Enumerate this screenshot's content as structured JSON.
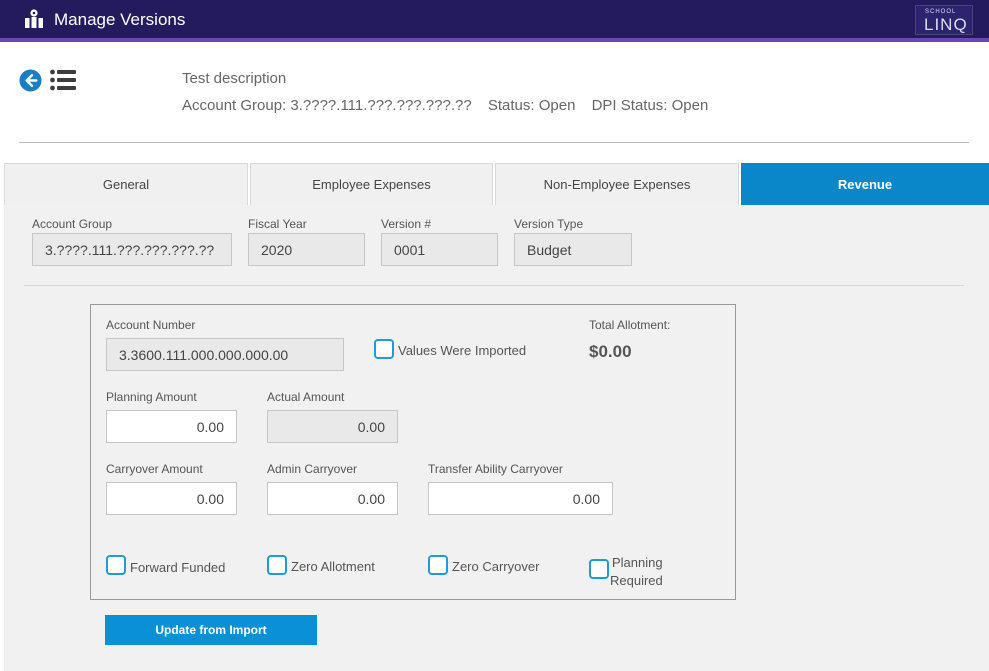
{
  "app": {
    "title": "Manage Versions",
    "logo_top": "SCHOOL",
    "logo_main": "LINQ"
  },
  "header": {
    "description": "Test description",
    "account_group": "Account Group: 3.????.111.???.???.???.??",
    "status": "Status: Open",
    "dpi_status": "DPI Status: Open"
  },
  "tabs": [
    {
      "label": "General",
      "active": false
    },
    {
      "label": "Employee Expenses",
      "active": false
    },
    {
      "label": "Non-Employee Expenses",
      "active": false
    },
    {
      "label": "Revenue",
      "active": true
    }
  ],
  "version_info": {
    "account_group_label": "Account Group",
    "account_group_value": "3.????.111.???.???.???.??",
    "fiscal_year_label": "Fiscal Year",
    "fiscal_year_value": "2020",
    "version_label": "Version #",
    "version_value": "0001",
    "version_type_label": "Version Type",
    "version_type_value": "Budget"
  },
  "form": {
    "account_number_label": "Account Number",
    "account_number_value": "3.3600.111.000.000.000.00",
    "values_imported_label": "Values Were Imported",
    "total_allotment_label": "Total Allotment:",
    "total_allotment_value": "$0.00",
    "planning_amount_label": "Planning Amount",
    "planning_amount_value": "0.00",
    "actual_amount_label": "Actual Amount",
    "actual_amount_value": "0.00",
    "carryover_amount_label": "Carryover Amount",
    "carryover_amount_value": "0.00",
    "admin_carryover_label": "Admin Carryover",
    "admin_carryover_value": "0.00",
    "transfer_ability_label": "Transfer Ability Carryover",
    "transfer_ability_value": "0.00",
    "forward_funded_label": "Forward Funded",
    "zero_allotment_label": "Zero Allotment",
    "zero_carryover_label": "Zero Carryover",
    "planning_required_line1": "Planning",
    "planning_required_line2": "Required"
  },
  "actions": {
    "update_from_import": "Update from Import"
  },
  "colors": {
    "topbar": "#241b5e",
    "accent": "#6a46b8",
    "active_tab": "#0a87c8",
    "checkbox": "#1f9bd6",
    "button": "#0a90d6"
  }
}
